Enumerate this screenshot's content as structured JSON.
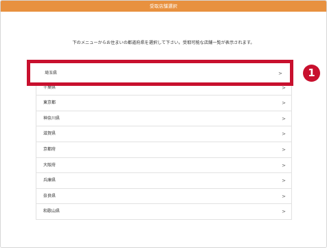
{
  "header": {
    "title": "受取店舗選択",
    "color": "#e8913f"
  },
  "instruction": "下のメニューからお住まいの都道府県を選択して下さい。受取可能な店舗一覧が表示されます。",
  "highlight": {
    "label": "埼玉県",
    "chevron": ">",
    "color": "#c8102e"
  },
  "step_badge": "1",
  "prefectures": [
    {
      "label": "千葉県",
      "chevron": ">"
    },
    {
      "label": "東京都",
      "chevron": ">"
    },
    {
      "label": "神奈川県",
      "chevron": ">"
    },
    {
      "label": "滋賀県",
      "chevron": ">"
    },
    {
      "label": "京都府",
      "chevron": ">"
    },
    {
      "label": "大阪府",
      "chevron": ">"
    },
    {
      "label": "兵庫県",
      "chevron": ">"
    },
    {
      "label": "奈良県",
      "chevron": ">"
    },
    {
      "label": "和歌山県",
      "chevron": ">"
    }
  ]
}
